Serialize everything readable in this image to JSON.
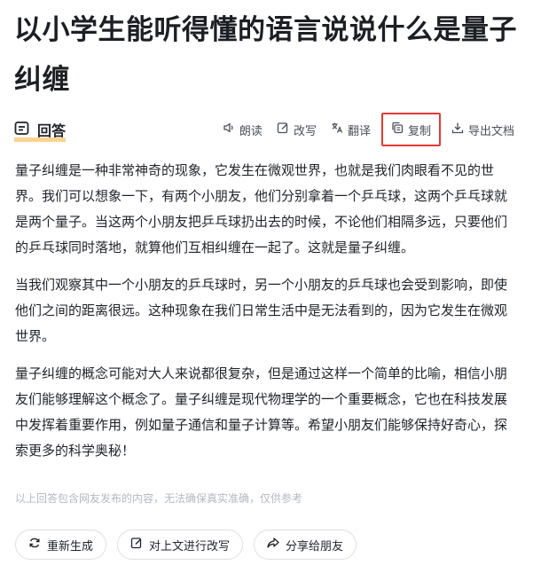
{
  "title": "以小学生能听得懂的语言说说什么是量子纠缠",
  "tab": {
    "label": "回答"
  },
  "actions": {
    "read": "朗读",
    "rewrite": "改写",
    "translate": "翻译",
    "copy": "复制",
    "export": "导出文档"
  },
  "answer": {
    "paragraphs": [
      "量子纠缠是一种非常神奇的现象，它发生在微观世界，也就是我们肉眼看不见的世界。我们可以想象一下，有两个小朋友，他们分别拿着一个乒乓球，这两个乒乓球就是两个量子。当这两个小朋友把乒乓球扔出去的时候，不论他们相隔多远，只要他们的乒乓球同时落地，就算他们互相纠缠在一起了。这就是量子纠缠。",
      "当我们观察其中一个小朋友的乒乓球时，另一个小朋友的乒乓球也会受到影响，即使他们之间的距离很远。这种现象在我们日常生活中是无法看到的，因为它发生在微观世界。",
      "量子纠缠的概念可能对大人来说都很复杂，但是通过这样一个简单的比喻，相信小朋友们能够理解这个概念了。量子纠缠是现代物理学的一个重要概念，它也在科技发展中发挥着重要作用，例如量子通信和量子计算等。希望小朋友们能够保持好奇心，探索更多的科学奥秘！"
    ]
  },
  "disclaimer": "以上回答包含网友发布的内容，无法确保真实准确，仅供参考",
  "bottom": {
    "regenerate": "重新生成",
    "rewrite_above": "对上文进行改写",
    "share": "分享给朋友"
  },
  "colors": {
    "highlight_border": "#e53935",
    "tab_underline": "#f7c46c"
  }
}
